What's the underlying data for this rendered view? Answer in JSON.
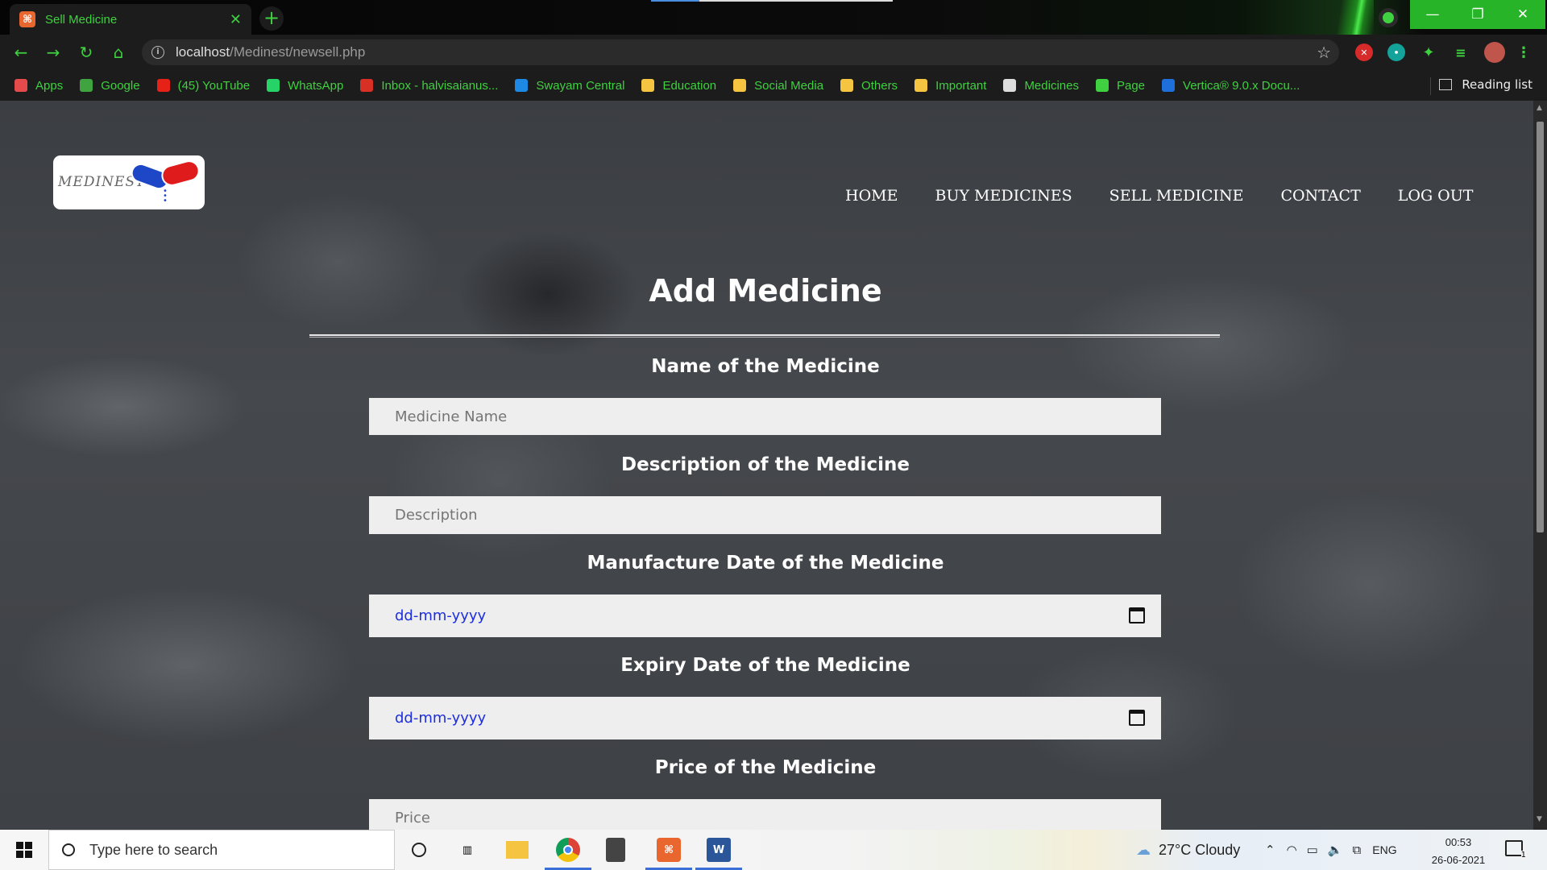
{
  "browser": {
    "tab_title": "Sell Medicine",
    "url_host": "localhost",
    "url_path": "/Medinest/newsell.php",
    "bookmarks": [
      {
        "label": "Apps",
        "icon": "apps-grid-icon",
        "color": "#e54b4b"
      },
      {
        "label": "Google",
        "icon": "google-icon",
        "color": "#3fa33f"
      },
      {
        "label": "(45) YouTube",
        "icon": "youtube-icon",
        "color": "#e62117"
      },
      {
        "label": "WhatsApp",
        "icon": "whatsapp-icon",
        "color": "#25d366"
      },
      {
        "label": "Inbox - halvisaianus...",
        "icon": "gmail-icon",
        "color": "#d93025"
      },
      {
        "label": "Swayam Central",
        "icon": "swayam-icon",
        "color": "#1e88e5"
      },
      {
        "label": "Education",
        "icon": "folder-icon",
        "color": "#f5c542"
      },
      {
        "label": "Social Media",
        "icon": "folder-icon",
        "color": "#f5c542"
      },
      {
        "label": "Others",
        "icon": "folder-icon",
        "color": "#f5c542"
      },
      {
        "label": "Important",
        "icon": "folder-icon",
        "color": "#f5c542"
      },
      {
        "label": "Medicines",
        "icon": "img-icon",
        "color": "#dddddd"
      },
      {
        "label": "Page",
        "icon": "wix-icon",
        "color": "#3fd13f"
      },
      {
        "label": "Vertica® 9.0.x Docu...",
        "icon": "vertica-icon",
        "color": "#1e6fd9"
      }
    ],
    "reading_list": "Reading list",
    "accent_color": "#3fd13f"
  },
  "site": {
    "logo_text": "MEDINEST",
    "nav": [
      "HOME",
      "BUY MEDICINES",
      "SELL MEDICINE",
      "CONTACT",
      "LOG OUT"
    ]
  },
  "form": {
    "title": "Add Medicine",
    "fields": [
      {
        "label": "Name of the Medicine",
        "placeholder": "Medicine Name",
        "type": "text"
      },
      {
        "label": "Description of the Medicine",
        "placeholder": "Description",
        "type": "text"
      },
      {
        "label": "Manufacture Date of the Medicine",
        "placeholder": "dd-mm-yyyy",
        "type": "date"
      },
      {
        "label": "Expiry Date of the Medicine",
        "placeholder": "dd-mm-yyyy",
        "type": "date"
      },
      {
        "label": "Price of the Medicine",
        "placeholder": "Price",
        "type": "text"
      }
    ]
  },
  "taskbar": {
    "search_placeholder": "Type here to search",
    "weather": "27°C  Cloudy",
    "language": "ENG",
    "time": "00:53",
    "date": "26-06-2021",
    "notification_count": "1"
  }
}
